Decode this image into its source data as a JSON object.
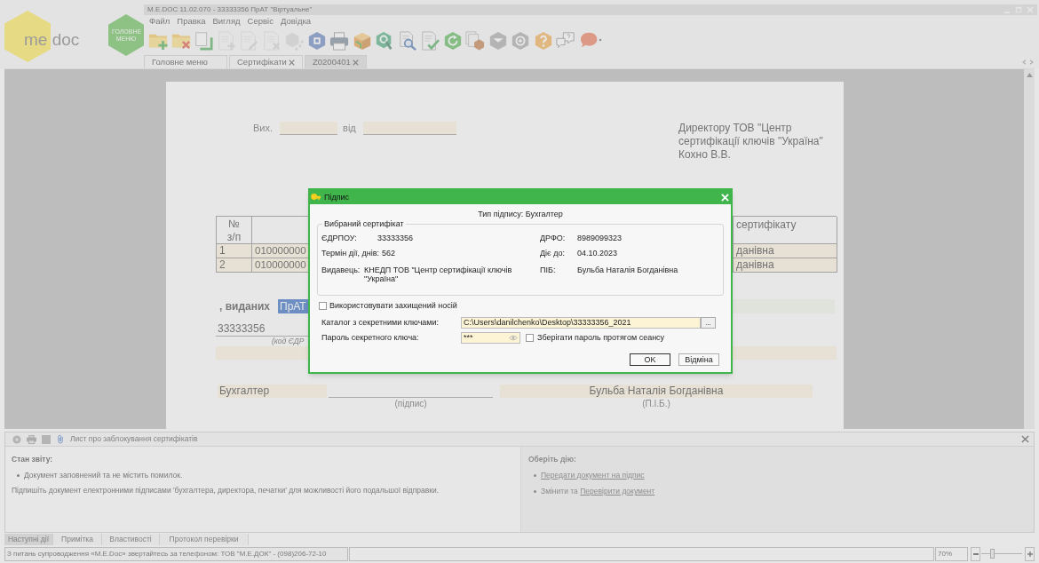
{
  "app": {
    "logo": "me doc",
    "main_menu": "ГОЛОВНЕ МЕНЮ"
  },
  "window": {
    "title": "M.E.DOC 11.02.070 - 33333356 ПрАТ \"Віртуальне\""
  },
  "menu": [
    "Файл",
    "Правка",
    "Вигляд",
    "Сервіс",
    "Довідка"
  ],
  "toolbar": [
    {
      "kind": "folder_add",
      "disabled": false
    },
    {
      "kind": "folder_remove",
      "disabled": false
    },
    {
      "kind": "pages",
      "disabled": false
    },
    {
      "kind": "doc_add",
      "disabled": true
    },
    {
      "kind": "doc_edit",
      "disabled": true
    },
    {
      "kind": "doc_remove",
      "disabled": true
    },
    {
      "kind": "hex_dots",
      "disabled": true
    },
    {
      "kind": "hex_square",
      "disabled": false
    },
    {
      "kind": "printer",
      "disabled": false
    },
    {
      "kind": "box",
      "disabled": false
    },
    {
      "kind": "hex_search",
      "disabled": false
    },
    {
      "kind": "doc_search",
      "disabled": false
    },
    {
      "kind": "doc_check",
      "disabled": false
    },
    {
      "kind": "hex_refresh",
      "disabled": false
    },
    {
      "kind": "pages_hex",
      "disabled": false
    },
    {
      "kind": "hex_chevron",
      "disabled": false
    },
    {
      "kind": "hex_ring",
      "disabled": false
    },
    {
      "kind": "hex_question",
      "disabled": false
    },
    {
      "kind": "speech_question",
      "disabled": false
    },
    {
      "kind": "speech",
      "disabled": false
    }
  ],
  "tabs": [
    {
      "label": "Головне меню",
      "selected": false,
      "closable": false
    },
    {
      "label": "Сертифікати",
      "selected": false,
      "closable": true
    },
    {
      "label": "Z0200401",
      "selected": true,
      "closable": true
    }
  ],
  "document": {
    "outgoing_label": "Вих.",
    "date_label": "від",
    "addressee": "Директору ТОВ \"Центр сертифікації ключів \"Україна\" Кохно В.В.",
    "table": {
      "header": {
        "number": "№ з/п",
        "column_3": "сертифікату"
      },
      "rows": [
        {
          "number": "1",
          "column_2": "010000000",
          "column_3": "данівна"
        },
        {
          "number": "2",
          "column_2": "010000000",
          "column_3": "данівна"
        }
      ]
    },
    "issued_label": ", виданих",
    "issued_to": {
      "value": "ПрАТ",
      "highlighted": true
    },
    "code": "33333356",
    "code_caption": "(код ЄДР",
    "signer_role": "Бухгалтер",
    "signature_caption": "(підпис)",
    "signer_name": "Бульба Наталія Богданівна",
    "name_caption": "(П.І.Б.)"
  },
  "dialog": {
    "title": "Підпис",
    "signature_type": "Тип підпису: Бухгалтер",
    "certificate": {
      "title": "Вибраний сертифікат",
      "rows": [
        {
          "left": {
            "label": "ЄДРПОУ:",
            "value": "33333356"
          },
          "right": {
            "label": "ДРФО:",
            "value": "8989099323"
          }
        },
        {
          "left": {
            "label": "Термін дії, днів:",
            "value": "562"
          },
          "right": {
            "label": "Діє до:",
            "value": "04.10.2023"
          }
        },
        {
          "left": {
            "label": "Видавець:",
            "value": "КНЕДП ТОВ \"Центр сертифікації ключів \"Україна\""
          },
          "right": {
            "label": "ПІБ:",
            "value": "Бульба Наталія Богданівна"
          }
        }
      ]
    },
    "protected_media": {
      "label": "Використовувати захищений носій",
      "checked": false
    },
    "key_directory": {
      "label": "Каталог з секретними ключами:",
      "value": "C:\\Users\\danilchenko\\Desktop\\33333356_2021",
      "browse": "..."
    },
    "password": {
      "label": "Пароль секретного ключа:",
      "value": "***"
    },
    "remember_password": {
      "label": "Зберігати пароль протягом сеансу",
      "checked": false
    },
    "buttons": [
      {
        "label": "OK",
        "default": true
      },
      {
        "label": "Відміна",
        "default": false
      }
    ]
  },
  "bottom_panel": {
    "title": "Лист про заблокування сертифікатів",
    "status_title": "Стан звіту:",
    "status_items": [
      "Документ заповнений та не містить помилок."
    ],
    "instruction": "Підпишіть документ електронними підписами 'бухгалтера, директора, печатки' для можливості його подальшої відправки.",
    "actions": {
      "title": "Оберіть дію:",
      "disabled": true,
      "items": [
        {
          "link": "Передати документ на підпис"
        },
        {
          "text": "Змінити та",
          "link": "Перевірити документ"
        }
      ]
    }
  },
  "bottom_tabs": [
    {
      "label": "Наступні дії",
      "selected": true
    },
    {
      "label": "Примітка",
      "selected": false
    },
    {
      "label": "Властивості",
      "selected": false
    },
    {
      "label": "Протокол перевірки",
      "selected": false
    }
  ],
  "status_bar": {
    "message": "З питань супроводження «M.E.Doc» звертайтесь за телефоном: ТОВ \"М.Е.ДОК\" - (098)206-72-10",
    "zoom": "70%",
    "zoom_slider": {
      "level": 0.25
    }
  }
}
